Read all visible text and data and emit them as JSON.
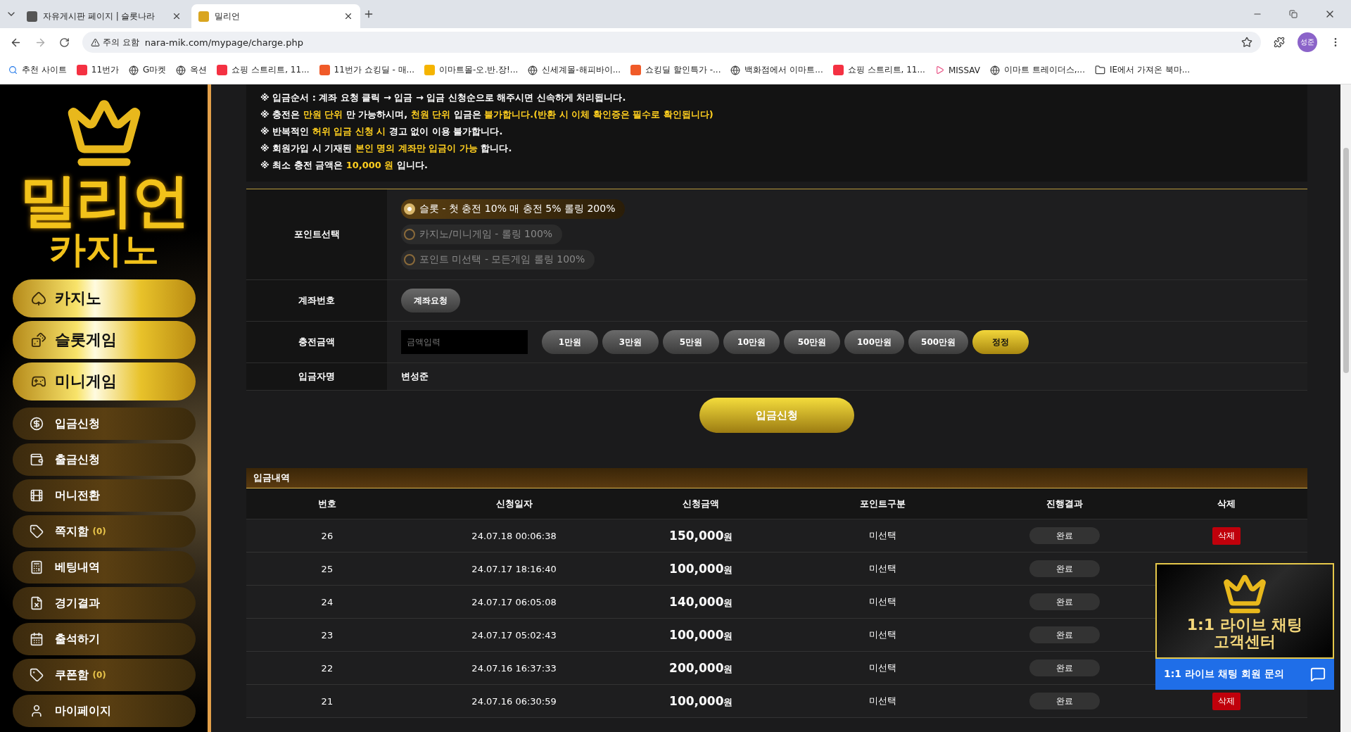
{
  "browser": {
    "tabs": [
      {
        "title": "자유게시판 페이지 | 슬롯나라",
        "selected": false
      },
      {
        "title": "밀리언",
        "selected": true
      }
    ],
    "address": {
      "warning": "주의 요함",
      "url": "nara-mik.com/mypage/charge.php"
    },
    "profile": "성준",
    "bookmarks": [
      {
        "label": "추천 사이트",
        "kind": "search"
      },
      {
        "label": "11번가",
        "kind": "shop"
      },
      {
        "label": "G마켓",
        "kind": "globe"
      },
      {
        "label": "옥션",
        "kind": "globe"
      },
      {
        "label": "쇼핑 스트리트, 11...",
        "kind": "shop"
      },
      {
        "label": "11번가 쇼킹딜 - 매...",
        "kind": "deal"
      },
      {
        "label": "이마트몰-오.반.장!...",
        "kind": "mall"
      },
      {
        "label": "신세계몰-해피바이...",
        "kind": "globe"
      },
      {
        "label": "쇼킹딜 할인특가 -...",
        "kind": "deal"
      },
      {
        "label": "백화점에서 이마트...",
        "kind": "globe"
      },
      {
        "label": "쇼핑 스트리트, 11...",
        "kind": "shop"
      },
      {
        "label": "MISSAV",
        "kind": "video"
      },
      {
        "label": "이마트 트레이더스,...",
        "kind": "globe"
      },
      {
        "label": "IE에서 가져온 북마...",
        "kind": "folder"
      }
    ]
  },
  "sidebar": {
    "logo": {
      "title": "밀리언",
      "subtitle": "카지노"
    },
    "games": [
      {
        "label": "카지노",
        "kind": "cards"
      },
      {
        "label": "슬롯게임",
        "kind": "slot"
      },
      {
        "label": "미니게임",
        "kind": "mini"
      }
    ],
    "menu": [
      {
        "label": "입금신청",
        "kind": "coin"
      },
      {
        "label": "출금신청",
        "kind": "wallet"
      },
      {
        "label": "머니전환",
        "kind": "film"
      },
      {
        "label": "쪽지함",
        "kind": "tag",
        "badge": "(0)"
      },
      {
        "label": "베팅내역",
        "kind": "grid"
      },
      {
        "label": "경기결과",
        "kind": "doc"
      },
      {
        "label": "출석하기",
        "kind": "calendar"
      },
      {
        "label": "쿠폰함",
        "kind": "tag",
        "badge": "(0)"
      },
      {
        "label": "마이페이지",
        "kind": "user"
      }
    ]
  },
  "notices": [
    "※ 입금순서 : 계좌 요청 클릭 → 입금 → 입금 신청순으로 해주시면 신속하게 처리됩니다.",
    "※ 충전은 **만원 단위** 만 가능하시며, **천원 단위** 입금은 **불가합니다.(반환 시 이체 확인증은 필수로 확인됩니다)**",
    "※ 반복적인 **허위 입금 신청 시** 경고 없이 이용 불가합니다.",
    "※ 회원가입 시 기재된 **본인 명의 계좌만 입금이 가능** 합니다.",
    "※ 최소 충전 금액은 **10,000 원** 입니다."
  ],
  "form": {
    "point_label": "포인트선택",
    "point_options": [
      {
        "label": "슬롯 - 첫 충전 10% 매 충전 5% 롤링 200%",
        "selected": true
      },
      {
        "label": "카지노/미니게임 - 롤링 100%",
        "selected": false
      },
      {
        "label": "포인트 미선택 - 모든게임 롤링 100%",
        "selected": false
      }
    ],
    "account_label": "계좌번호",
    "account_button": "계좌요청",
    "amount_label": "충전금액",
    "amount_placeholder": "금액입력",
    "amount_buttons": [
      {
        "label": "1만원",
        "kind": "add"
      },
      {
        "label": "3만원",
        "kind": "add"
      },
      {
        "label": "5만원",
        "kind": "add"
      },
      {
        "label": "10만원",
        "kind": "add"
      },
      {
        "label": "50만원",
        "kind": "add"
      },
      {
        "label": "100만원",
        "kind": "add"
      },
      {
        "label": "500만원",
        "kind": "add"
      },
      {
        "label": "정정",
        "kind": "reset"
      }
    ],
    "name_label": "입금자명",
    "name_value": "변성준",
    "submit": "입금신청"
  },
  "history": {
    "title": "입금내역",
    "columns": [
      "번호",
      "신청일자",
      "신청금액",
      "포인트구분",
      "진행결과",
      "삭제"
    ],
    "rows": [
      {
        "no": "26",
        "date": "24.07.18 00:06:38",
        "amount": "150,000",
        "unit": "원",
        "point": "미선택",
        "status": "완료",
        "delete": "삭제"
      },
      {
        "no": "25",
        "date": "24.07.17 18:16:40",
        "amount": "100,000",
        "unit": "원",
        "point": "미선택",
        "status": "완료"
      },
      {
        "no": "24",
        "date": "24.07.17 06:05:08",
        "amount": "140,000",
        "unit": "원",
        "point": "미선택",
        "status": "완료"
      },
      {
        "no": "23",
        "date": "24.07.17 05:02:43",
        "amount": "100,000",
        "unit": "원",
        "point": "미선택",
        "status": "완료"
      },
      {
        "no": "22",
        "date": "24.07.16 16:37:33",
        "amount": "200,000",
        "unit": "원",
        "point": "미선택",
        "status": "완료"
      },
      {
        "no": "21",
        "date": "24.07.16 06:30:59",
        "amount": "100,000",
        "unit": "원",
        "point": "미선택",
        "status": "완료",
        "delete": "삭제"
      }
    ]
  },
  "chat": {
    "banner_line1": "1:1 라이브 채팅",
    "banner_line2": "고객센터",
    "bar": "1:1 라이브 채팅 회원 문의"
  }
}
